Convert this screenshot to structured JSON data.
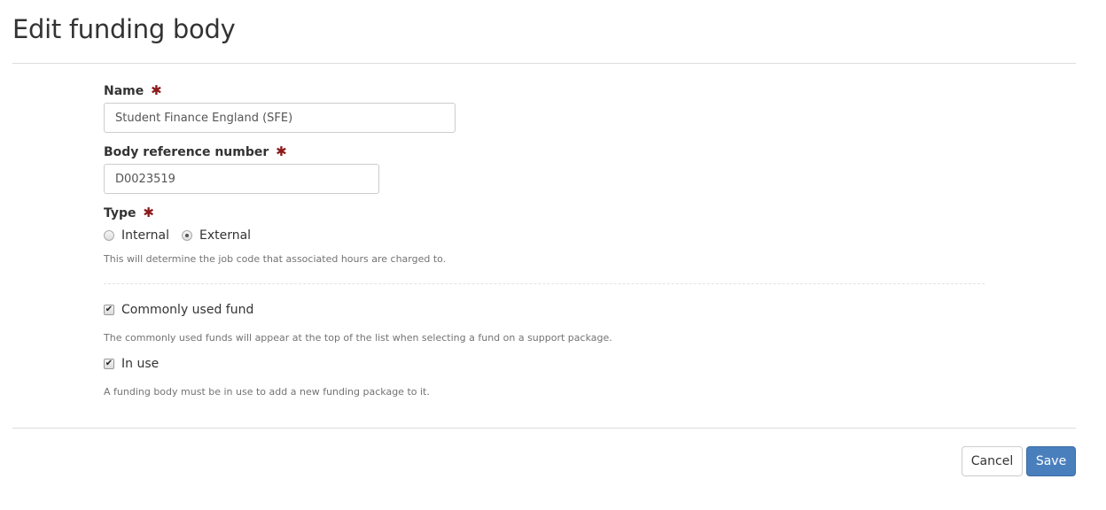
{
  "page": {
    "title": "Edit funding body"
  },
  "form": {
    "name": {
      "label": "Name",
      "required_icon": "✱",
      "value": "Student Finance England (SFE)"
    },
    "reference": {
      "label": "Body reference number",
      "required_icon": "✱",
      "value": "D0023519"
    },
    "type": {
      "label": "Type",
      "required_icon": "✱",
      "options": [
        {
          "label": "Internal",
          "selected": false
        },
        {
          "label": "External",
          "selected": true
        }
      ],
      "help": "This will determine the job code that associated hours are charged to."
    },
    "commonly_used": {
      "label": "Commonly used fund",
      "checked": true,
      "check_glyph": "✔",
      "help": "The commonly used funds will appear at the top of the list when selecting a fund on a support package."
    },
    "in_use": {
      "label": "In use",
      "checked": true,
      "check_glyph": "✔",
      "help": "A funding body must be in use to add a new funding package to it."
    }
  },
  "footer": {
    "cancel_label": "Cancel",
    "save_label": "Save"
  },
  "colors": {
    "primary": "#4a7fbd",
    "required": "#8b1a1a"
  }
}
